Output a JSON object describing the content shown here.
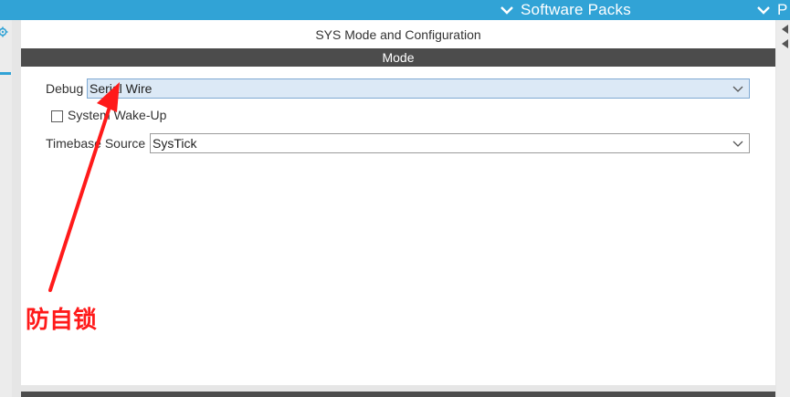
{
  "header": {
    "menus": [
      {
        "label": "Software Packs",
        "icon": "chevron-down-icon"
      },
      {
        "label": "P",
        "icon": "chevron-down-icon"
      }
    ]
  },
  "panel": {
    "title": "SYS Mode and Configuration",
    "section_header": "Mode"
  },
  "form": {
    "debug": {
      "label": "Debug",
      "value": "Serial Wire"
    },
    "wakeup": {
      "label": "System Wake-Up",
      "checked": false
    },
    "timebase": {
      "label": "Timebase Source",
      "value": "SysTick"
    }
  },
  "annotation": {
    "text": "防自锁",
    "color": "#ff1a1a"
  },
  "colors": {
    "header_blue": "#31a3d6",
    "mode_bar": "#4c4c4c",
    "debug_select_bg": "#dce9f6"
  }
}
